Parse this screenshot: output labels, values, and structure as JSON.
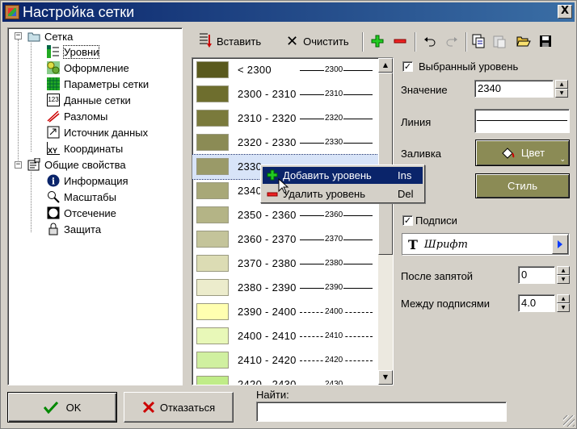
{
  "window": {
    "title": "Настройка сетки",
    "close": "X"
  },
  "tree": {
    "items": [
      {
        "label": "Сетка",
        "icon": "folder-icon"
      },
      {
        "label": "Уровни",
        "icon": "levels-icon"
      },
      {
        "label": "Оформление",
        "icon": "design-icon"
      },
      {
        "label": "Параметры сетки",
        "icon": "grid-params-icon"
      },
      {
        "label": "Данные сетки",
        "icon": "grid-data-icon"
      },
      {
        "label": "Разломы",
        "icon": "faults-icon"
      },
      {
        "label": "Источник данных",
        "icon": "data-source-icon"
      },
      {
        "label": "Координаты",
        "icon": "coordinates-icon"
      },
      {
        "label": "Общие свойства",
        "icon": "general-properties-icon"
      },
      {
        "label": "Информация",
        "icon": "info-icon"
      },
      {
        "label": "Масштабы",
        "icon": "zoom-icon"
      },
      {
        "label": "Отсечение",
        "icon": "clip-icon"
      },
      {
        "label": "Защита",
        "icon": "lock-icon"
      }
    ],
    "icon_glyphs": {
      "grid_data": "123",
      "coordinates": "XY"
    }
  },
  "toolbar": {
    "insert": "Вставить",
    "clear": "Очистить"
  },
  "levels": {
    "rows": [
      {
        "label": "< 2300",
        "line": "2300",
        "color": "#5a5a1e",
        "dashed": false
      },
      {
        "label": "2300 - 2310",
        "line": "2310",
        "color": "#6e6e2e",
        "dashed": false
      },
      {
        "label": "2310 - 2320",
        "line": "2320",
        "color": "#7a7a3c",
        "dashed": false
      },
      {
        "label": "2320 - 2330",
        "line": "2330",
        "color": "#8b8b55",
        "dashed": false
      },
      {
        "label": "2330",
        "line": "",
        "color": "#9a9a68",
        "dashed": false
      },
      {
        "label": "2340",
        "line": "",
        "color": "#a8a878",
        "dashed": false
      },
      {
        "label": "2350 - 2360",
        "line": "2360",
        "color": "#b4b486",
        "dashed": false
      },
      {
        "label": "2360 - 2370",
        "line": "2370",
        "color": "#c4c49a",
        "dashed": false
      },
      {
        "label": "2370 - 2380",
        "line": "2380",
        "color": "#dcdcb4",
        "dashed": false
      },
      {
        "label": "2380 - 2390",
        "line": "2390",
        "color": "#ececcc",
        "dashed": false
      },
      {
        "label": "2390 - 2400",
        "line": "2400",
        "color": "#ffffb0",
        "dashed": true
      },
      {
        "label": "2400 - 2410",
        "line": "2410",
        "color": "#e8f8b8",
        "dashed": true
      },
      {
        "label": "2410 - 2420",
        "line": "2420",
        "color": "#d0f0a0",
        "dashed": true
      },
      {
        "label": "2420 - 2430",
        "line": "2430",
        "color": "#c0ec88",
        "dashed": true
      }
    ],
    "selected_index": 4
  },
  "context_menu": {
    "add": {
      "label": "Добавить уровень",
      "key": "Ins"
    },
    "remove": {
      "label": "Удалить уровень",
      "key": "Del"
    }
  },
  "props": {
    "selected_level": "Выбранный уровень",
    "value_label": "Значение",
    "value": "2340",
    "line_label": "Линия",
    "fill_label": "Заливка",
    "color_button": "Цвет",
    "style_button": "Стиль",
    "labels_check": "Подписи",
    "font_button": "Шрифт",
    "decimals_label": "После запятой",
    "decimals": "0",
    "spacing_label": "Между подписями",
    "spacing": "4.0"
  },
  "footer": {
    "ok": "OK",
    "cancel": "Отказаться",
    "find_label": "Найти:",
    "find_value": ""
  },
  "colors": {
    "title_start": "#0a246a",
    "title_end": "#3a6ea5",
    "accent_olive": "#8b8b55",
    "selection": "#0a246a"
  }
}
